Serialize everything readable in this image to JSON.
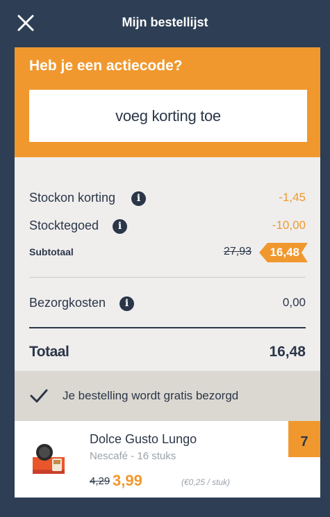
{
  "header": {
    "title": "Mijn bestellijst",
    "close_icon": "close-icon"
  },
  "promo": {
    "title": "Heb je een actiecode?",
    "button_label": "voeg korting toe"
  },
  "summary": {
    "stockon": {
      "label": "Stockon korting",
      "value": "-1,45"
    },
    "stocktegoed": {
      "label": "Stocktegoed",
      "value": "-10,00"
    },
    "subtotal": {
      "label": "Subtotaal",
      "old_value": "27,93",
      "value": "16,48"
    },
    "delivery_cost": {
      "label": "Bezorgkosten",
      "value": "0,00"
    },
    "total": {
      "label": "Totaal",
      "value": "16,48"
    },
    "info_icon_glyph": "i"
  },
  "delivery_notice": {
    "text": "Je bestelling wordt gratis bezorgd"
  },
  "product": {
    "name": "Dolce Gusto Lungo",
    "subtitle": "Nescafé - 16 stuks",
    "old_price": "4,29",
    "price": "3,99",
    "unit_price": "(€0,25 / stuk)",
    "quantity": "7"
  },
  "colors": {
    "background": "#2d3e55",
    "accent_orange": "#f0982e",
    "text_dark": "#2b3648",
    "panel": "#efeeed",
    "notice": "#dbd8d1"
  }
}
